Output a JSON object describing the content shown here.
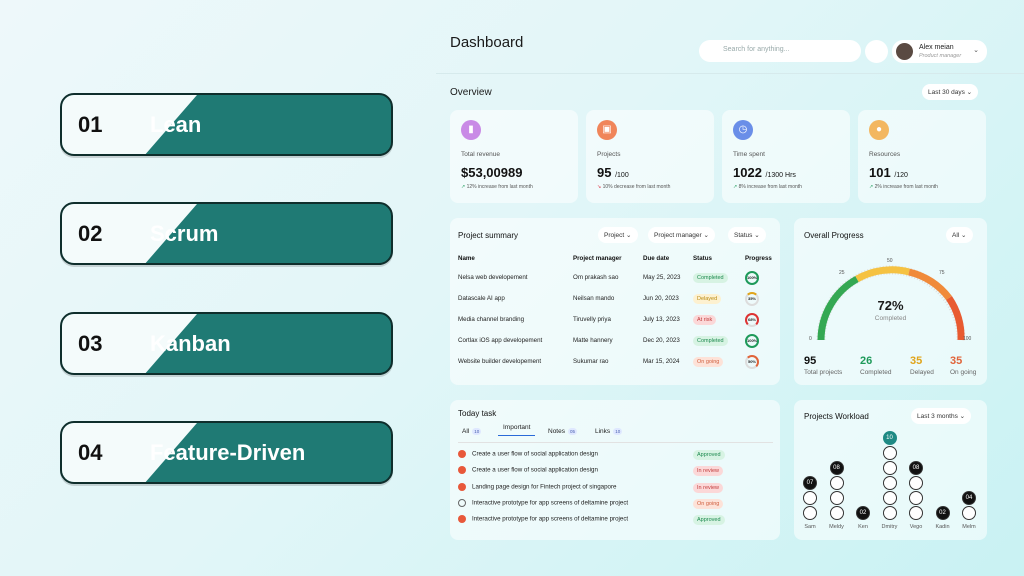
{
  "methods": [
    {
      "num": "01",
      "label": "Lean"
    },
    {
      "num": "02",
      "label": "Scrum"
    },
    {
      "num": "03",
      "label": "Kanban"
    },
    {
      "num": "04",
      "label": "Feature-Driven"
    }
  ],
  "header": {
    "title": "Dashboard",
    "search_placeholder": "Search for anything...",
    "user_name": "Alex meian",
    "user_role": "Product manager"
  },
  "overview": {
    "title": "Overview",
    "range": "Last 30 days",
    "cards": [
      {
        "icon": "chart-icon",
        "color": "#c98ae6",
        "label": "Total revenue",
        "value": "$53,00989",
        "unit": "",
        "trend": "12% increase from last month",
        "trend_dir": "up"
      },
      {
        "icon": "briefcase-icon",
        "color": "#f0855a",
        "label": "Projects",
        "value": "95",
        "unit": "/100",
        "trend": "10% decrease from last month",
        "trend_dir": "down"
      },
      {
        "icon": "clock-icon",
        "color": "#6a8ee8",
        "label": "Time spent",
        "value": "1022",
        "unit": "/1300 Hrs",
        "trend": "8% increase from last month",
        "trend_dir": "up"
      },
      {
        "icon": "person-icon",
        "color": "#f3b760",
        "label": "Resources",
        "value": "101",
        "unit": "/120",
        "trend": "2% increase from last month",
        "trend_dir": "up"
      }
    ]
  },
  "project_summary": {
    "title": "Project summary",
    "filters": [
      "Project",
      "Project manager",
      "Status"
    ],
    "columns": [
      "Name",
      "Project manager",
      "Due date",
      "Status",
      "Progress"
    ],
    "rows": [
      {
        "name": "Nelsa web developement",
        "manager": "Om prakash sao",
        "due": "May 25, 2023",
        "status": "Completed",
        "status_color": "green",
        "progress": "100%"
      },
      {
        "name": "Datascale AI app",
        "manager": "Neilsan mando",
        "due": "Jun 20, 2023",
        "status": "Delayed",
        "status_color": "yellow",
        "progress": "35%"
      },
      {
        "name": "Media channel branding",
        "manager": "Tiruvelly priya",
        "due": "July 13, 2023",
        "status": "At risk",
        "status_color": "red",
        "progress": "68%"
      },
      {
        "name": "Cortlax iOS app developement",
        "manager": "Matte hannery",
        "due": "Dec 20, 2023",
        "status": "Completed",
        "status_color": "green",
        "progress": "100%"
      },
      {
        "name": "Website builder developement",
        "manager": "Sukumar rao",
        "due": "Mar 15, 2024",
        "status": "On going",
        "status_color": "peach",
        "progress": "50%"
      }
    ]
  },
  "overall_progress": {
    "title": "Overall Progress",
    "filter": "All",
    "percent": "72%",
    "percent_label": "Completed",
    "ticks": [
      "0",
      "25",
      "50",
      "75",
      "100"
    ],
    "stats": [
      {
        "value": "95",
        "label": "Total projects",
        "color": "#111111"
      },
      {
        "value": "26",
        "label": "Completed",
        "color": "#1e9a5a"
      },
      {
        "value": "35",
        "label": "Delayed",
        "color": "#e0a41a"
      },
      {
        "value": "35",
        "label": "On going",
        "color": "#e0643a"
      }
    ]
  },
  "today_task": {
    "title": "Today task",
    "tabs": [
      {
        "label": "All",
        "count": "10"
      },
      {
        "label": "Important",
        "count": ""
      },
      {
        "label": "Notes",
        "count": "05"
      },
      {
        "label": "Links",
        "count": "10"
      }
    ],
    "tasks": [
      {
        "text": "Create a user flow of social application design",
        "done": true,
        "status": "Approved",
        "status_color": "green"
      },
      {
        "text": "Create a user flow of social application design",
        "done": true,
        "status": "In review",
        "status_color": "red"
      },
      {
        "text": "Landing page design for Fintech project of singapore",
        "done": true,
        "status": "In review",
        "status_color": "red"
      },
      {
        "text": "Interactive prototype for app screens of deltamine project",
        "done": false,
        "status": "On going",
        "status_color": "peach"
      },
      {
        "text": "Interactive prototype for app screens of deltamine project",
        "done": true,
        "status": "Approved",
        "status_color": "green"
      }
    ]
  },
  "workload": {
    "title": "Projects Workload",
    "range": "Last 3 months",
    "people": [
      {
        "name": "Sam",
        "count": "07",
        "level": 3
      },
      {
        "name": "Meldy",
        "count": "08",
        "level": 4
      },
      {
        "name": "Ken",
        "count": "02",
        "level": 1
      },
      {
        "name": "Dmitry",
        "count": "10",
        "level": 6
      },
      {
        "name": "Vego",
        "count": "08",
        "level": 4
      },
      {
        "name": "Kadin",
        "count": "02",
        "level": 1
      },
      {
        "name": "Melm",
        "count": "04",
        "level": 2
      }
    ]
  }
}
